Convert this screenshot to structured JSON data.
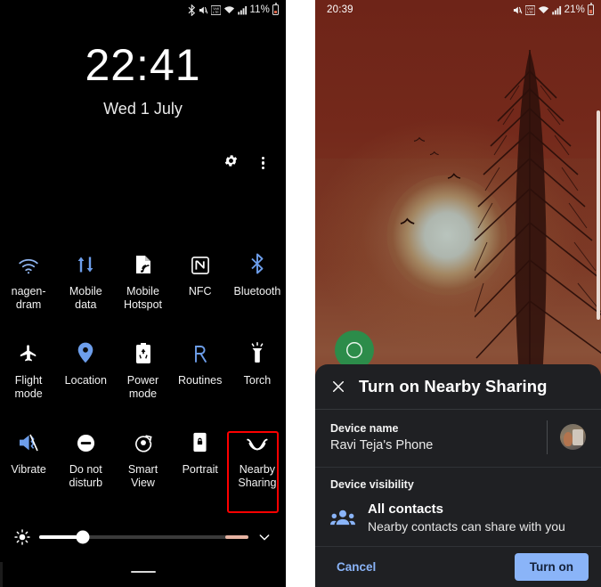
{
  "left_phone": {
    "status_bar": {
      "battery_percent": "11%",
      "icons": [
        "bluetooth-icon",
        "mute-vibrate-icon",
        "volte-icon",
        "wifi-icon",
        "signal-icon"
      ],
      "battery_icon": "battery-low-icon"
    },
    "lock_clock": {
      "time": "22:41",
      "date": "Wed 1 July"
    },
    "header_actions": [
      {
        "name": "settings-gear-button",
        "icon": "gear-icon"
      },
      {
        "name": "overflow-menu-button",
        "icon": "kebab-menu-icon"
      }
    ],
    "tiles": [
      [
        {
          "label": "nagen-dram",
          "icon": "wifi-icon",
          "active": true
        },
        {
          "label": "Mobile data",
          "icon": "mobile-data-icon",
          "active": true
        },
        {
          "label": "Mobile Hotspot",
          "icon": "hotspot-icon",
          "active": false
        },
        {
          "label": "NFC",
          "icon": "nfc-icon",
          "active": false
        },
        {
          "label": "Bluetooth",
          "icon": "bluetooth-icon",
          "active": true
        }
      ],
      [
        {
          "label": "Flight mode",
          "icon": "airplane-icon",
          "active": false
        },
        {
          "label": "Location",
          "icon": "location-pin-icon",
          "active": true
        },
        {
          "label": "Power mode",
          "icon": "power-mode-icon",
          "active": false
        },
        {
          "label": "Routines",
          "icon": "routines-icon",
          "active": true
        },
        {
          "label": "Torch",
          "icon": "torch-icon",
          "active": false
        }
      ],
      [
        {
          "label": "Vibrate",
          "icon": "vibrate-icon",
          "active": true
        },
        {
          "label": "Do not disturb",
          "icon": "do-not-disturb-icon",
          "active": false
        },
        {
          "label": "Smart View",
          "icon": "smart-view-icon",
          "active": false
        },
        {
          "label": "Portrait",
          "icon": "rotation-lock-icon",
          "active": false
        },
        {
          "label": "Nearby Sharing",
          "icon": "nearby-sharing-icon",
          "active": false,
          "highlighted": true
        }
      ]
    ],
    "brightness": {
      "icon": "brightness-icon",
      "value_percent": 21,
      "expand_icon": "chevron-down-icon"
    },
    "highlight_color": "#fe0000"
  },
  "right_phone": {
    "status_bar": {
      "time": "20:39",
      "battery_percent": "21%",
      "icons": [
        "mute-vibrate-icon",
        "volte-icon",
        "wifi-icon",
        "signal-icon"
      ],
      "battery_icon": "battery-icon"
    },
    "wallpaper": {
      "name": "sunset-forest-wallpaper",
      "sky_color": "#6e2418",
      "sun_color": "#b9c4bd"
    },
    "dialog": {
      "title": "Turn on Nearby Sharing",
      "close_icon": "close-icon",
      "device_name": {
        "label": "Device name",
        "value": "Ravi Teja's Phone",
        "avatar": "user-avatar"
      },
      "device_visibility": {
        "label": "Device visibility",
        "option_title": "All contacts",
        "option_subtitle": "Nearby contacts can share with you",
        "icon": "contacts-group-icon"
      },
      "cancel_label": "Cancel",
      "confirm_label": "Turn on",
      "accent_color": "#8ab4f8"
    }
  }
}
